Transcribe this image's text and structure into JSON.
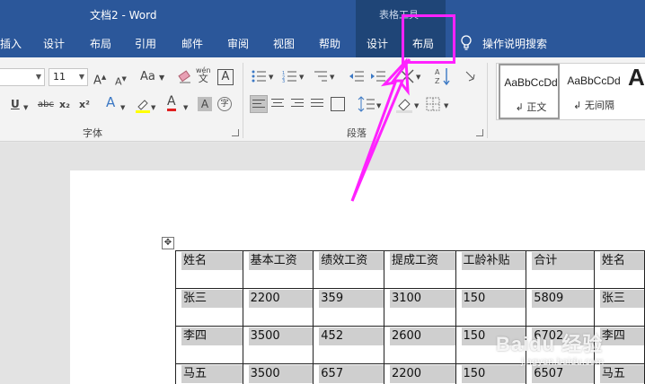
{
  "window": {
    "title": "文档2  -  Word",
    "context_tab_group": "表格工具"
  },
  "tabs": [
    "插入",
    "设计",
    "布局",
    "引用",
    "邮件",
    "审阅",
    "视图",
    "帮助"
  ],
  "context_tabs": [
    "设计",
    "布局"
  ],
  "tell_me": "操作说明搜索",
  "ribbon": {
    "font_size": "11",
    "font_size_grow": "A",
    "font_size_shrink": "A",
    "change_case": "Aa",
    "pinyin_label": "wén",
    "pinyin_char": "文",
    "char_border": "A",
    "underline": "U",
    "strikethrough": "abc",
    "subscript": "x₂",
    "superscript": "x²",
    "text_effect": "A",
    "font_color": "A",
    "char_shading": "A",
    "enclose_char": "字",
    "font_group_label": "字体",
    "paragraph_group_label": "段落",
    "styles": [
      {
        "sample": "AaBbCcDd",
        "name": "正文"
      },
      {
        "sample": "AaBbCcDd",
        "name": "无间隔"
      },
      {
        "sample": "A",
        "name": ""
      }
    ]
  },
  "table": {
    "headers": [
      "姓名",
      "基本工资",
      "绩效工资",
      "提成工资",
      "工龄补贴",
      "合计",
      "姓名"
    ],
    "rows": [
      [
        "张三",
        "2200",
        "359",
        "3100",
        "150",
        "5809",
        "张三"
      ],
      [
        "李四",
        "3500",
        "452",
        "2600",
        "150",
        "6702",
        "李四"
      ],
      [
        "马五",
        "3500",
        "657",
        "2200",
        "150",
        "6507",
        "马五"
      ]
    ]
  },
  "annotation_color": "#ff22ff",
  "watermark": {
    "text": "Baidu 经验",
    "url": "jingyan.baidu.com"
  }
}
